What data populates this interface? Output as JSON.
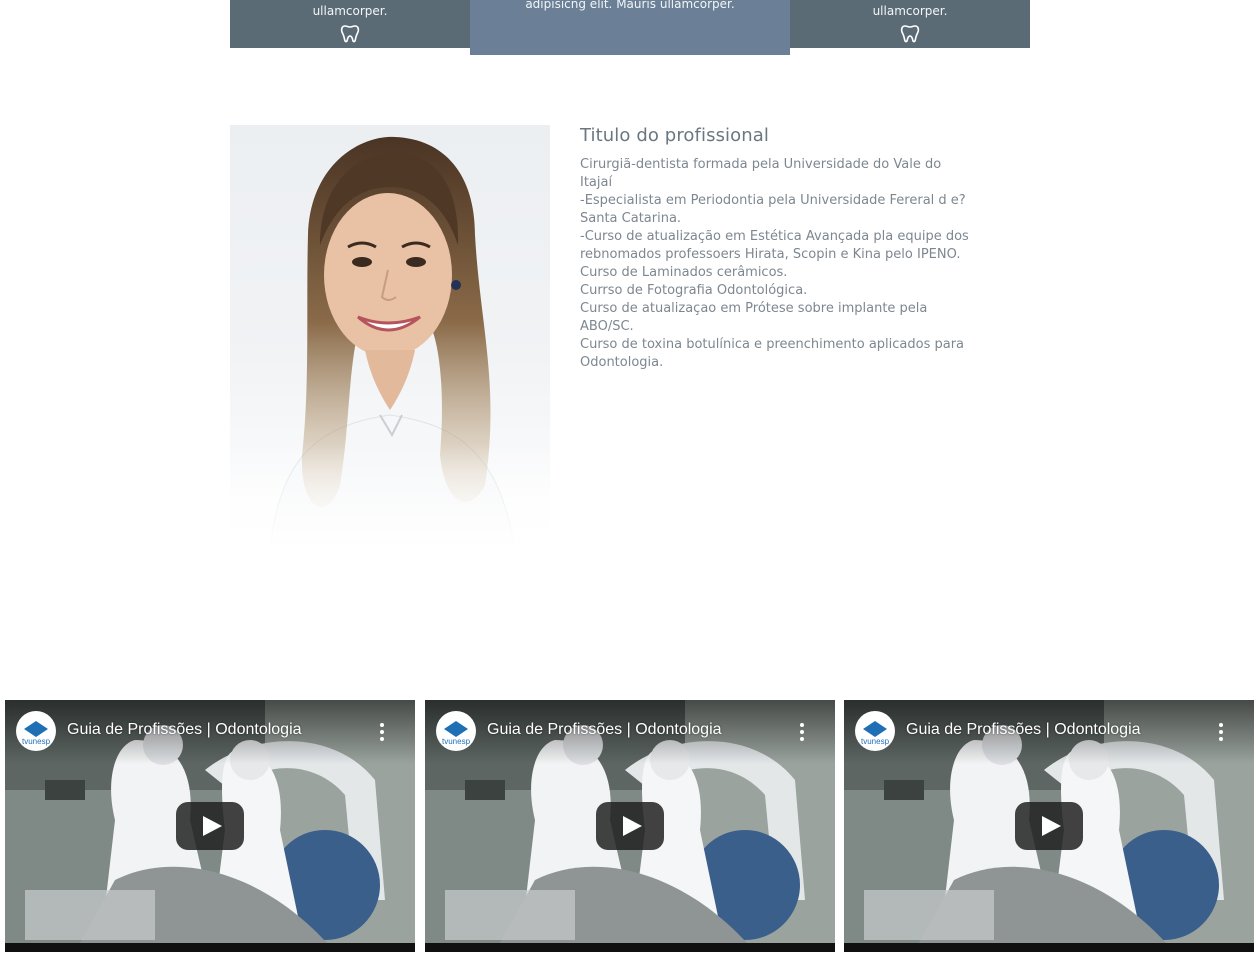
{
  "cards": [
    {
      "text": "ullamcorper.",
      "icon": "tooth-icon"
    },
    {
      "text": "adipisicng elit. Mauris ullamcorper."
    },
    {
      "text": "ullamcorper.",
      "icon": "tooth-icon"
    }
  ],
  "colors": {
    "card_dark": "#5b6b76",
    "card_active": "#6b8096",
    "text_gray": "#7d8790"
  },
  "professional": {
    "title": "Titulo do profissional",
    "lines": [
      "Cirurgiã-dentista formada pela Universidade do Vale do",
      "Itajaí",
      "-Especialista em Periodontia pela Universidade Fereral d e?",
      "Santa Catarina.",
      "-Curso de atualização em Estética Avançada pla equipe dos",
      "rebnomados professoers Hirata, Scopin e Kina pelo IPENO.",
      "Curso de Laminados cerâmicos.",
      "Currso de Fotografia Odontológica.",
      "Curso de atualizaçao em Prótese sobre implante pela",
      "ABO/SC.",
      "Curso de toxina botulínica e preenchimento aplicados para",
      "Odontologia."
    ]
  },
  "videos": [
    {
      "title": "Guia de Profissões | Odontologia",
      "channel_logo": "tvunesp"
    },
    {
      "title": "Guia de Profissões | Odontologia",
      "channel_logo": "tvunesp"
    },
    {
      "title": "Guia de Profissões | Odontologia",
      "channel_logo": "tvunesp"
    }
  ]
}
